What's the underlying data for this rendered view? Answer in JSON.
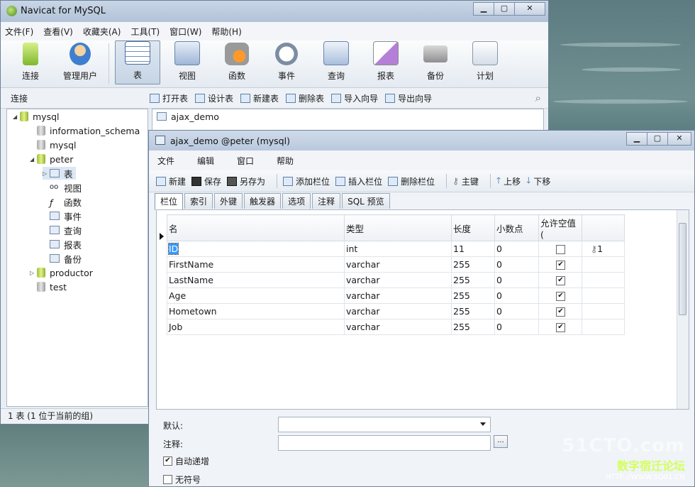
{
  "main_window": {
    "title": "Navicat for MySQL",
    "menu": [
      "文件(F)",
      "查看(V)",
      "收藏夹(A)",
      "工具(T)",
      "窗口(W)",
      "帮助(H)"
    ],
    "toolbar": [
      "连接",
      "管理用户",
      "表",
      "视图",
      "函数",
      "事件",
      "查询",
      "报表",
      "备份",
      "计划"
    ],
    "connection_label": "连接",
    "object_toolbar": [
      "打开表",
      "设计表",
      "新建表",
      "删除表",
      "导入向导",
      "导出向导"
    ],
    "tree": {
      "root": "mysql",
      "databases": [
        "information_schema",
        "mysql",
        "peter",
        "productor",
        "test"
      ],
      "peter_children": [
        "表",
        "视图",
        "函数",
        "事件",
        "查询",
        "报表",
        "备份"
      ]
    },
    "object_item": "ajax_demo",
    "status": "1 表 (1 位于当前的组)"
  },
  "child_window": {
    "title": "ajax_demo @peter (mysql)",
    "menu": [
      "文件",
      "编辑",
      "窗口",
      "帮助"
    ],
    "toolbar": [
      "新建",
      "保存",
      "另存为",
      "添加栏位",
      "插入栏位",
      "删除栏位",
      "主键",
      "上移",
      "下移"
    ],
    "tabs": [
      "栏位",
      "索引",
      "外键",
      "触发器",
      "选项",
      "注释",
      "SQL 预览"
    ],
    "columns": [
      "名",
      "类型",
      "长度",
      "小数点",
      "允许空值 ("
    ],
    "rows": [
      {
        "name": "ID",
        "type": "int",
        "length": "11",
        "decimals": "0",
        "nullable": false,
        "key": "1"
      },
      {
        "name": "FirstName",
        "type": "varchar",
        "length": "255",
        "decimals": "0",
        "nullable": true,
        "key": ""
      },
      {
        "name": "LastName",
        "type": "varchar",
        "length": "255",
        "decimals": "0",
        "nullable": true,
        "key": ""
      },
      {
        "name": "Age",
        "type": "varchar",
        "length": "255",
        "decimals": "0",
        "nullable": true,
        "key": ""
      },
      {
        "name": "Hometown",
        "type": "varchar",
        "length": "255",
        "decimals": "0",
        "nullable": true,
        "key": ""
      },
      {
        "name": "Job",
        "type": "varchar",
        "length": "255",
        "decimals": "0",
        "nullable": true,
        "key": ""
      }
    ],
    "props": {
      "default_label": "默认:",
      "comment_label": "注释:",
      "auto_increment": "自动递增",
      "unsigned": "无符号",
      "dots": "..."
    }
  },
  "watermark": {
    "line1": "51CTO.com",
    "line2": "数字宿迁论坛",
    "line3": "HTTP://WWW.SQ01.CN"
  }
}
